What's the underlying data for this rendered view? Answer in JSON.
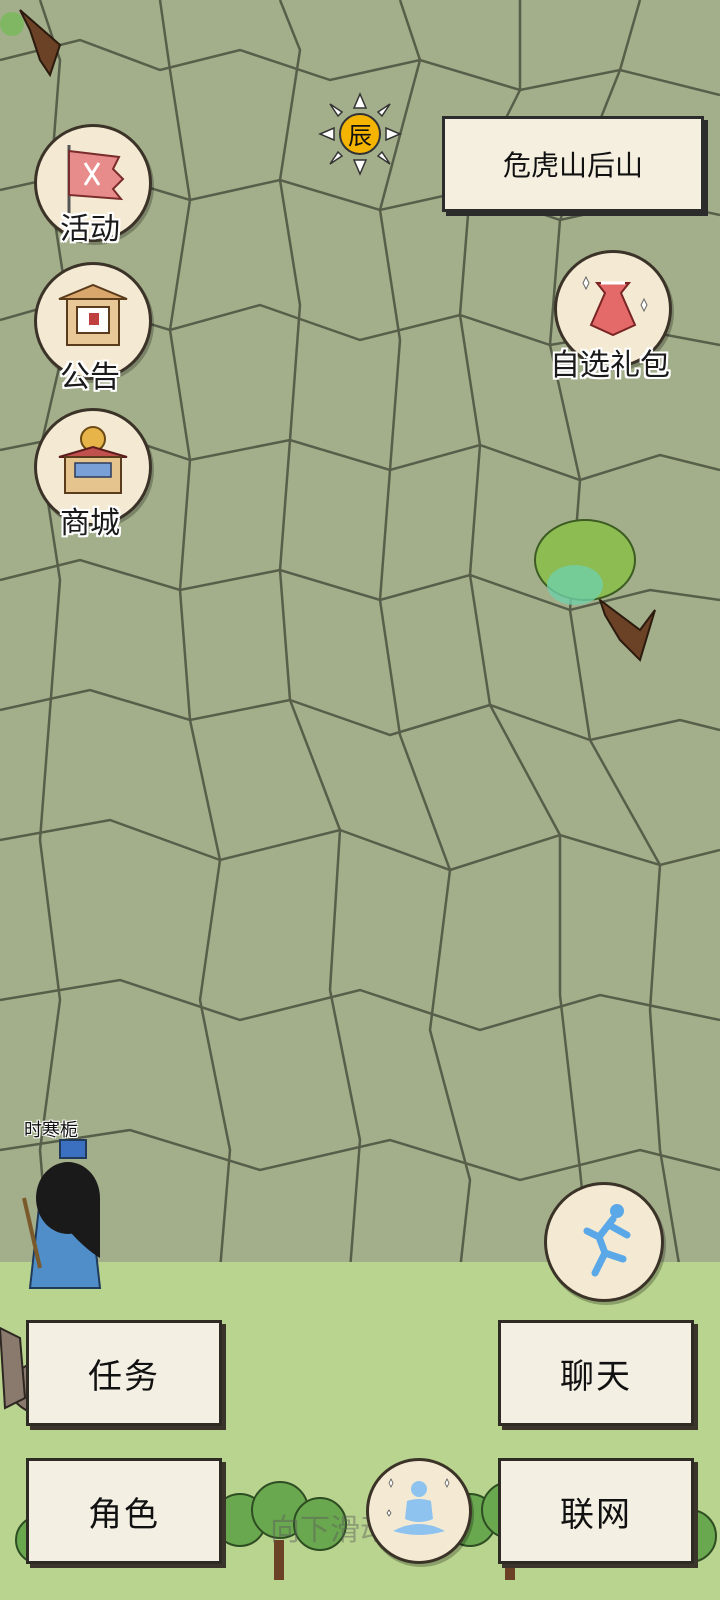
{
  "map": {
    "location_name": "危虎山后山",
    "time_marker": "辰"
  },
  "left_menu": [
    {
      "label": "活动",
      "icon": "banner-flag-icon"
    },
    {
      "label": "公告",
      "icon": "notice-pavilion-icon"
    },
    {
      "label": "商城",
      "icon": "shop-building-icon"
    }
  ],
  "right_menu": {
    "gift_label": "自选礼包",
    "gift_icon": "gift-pouch-icon"
  },
  "player": {
    "name": "时寒栀"
  },
  "bottom_buttons": {
    "task": "任务",
    "chat": "聊天",
    "character": "角色",
    "online": "联网"
  },
  "hint_text": "向下滑动屏幕",
  "icons": {
    "run": "running-figure-icon",
    "meditate": "meditation-figure-icon",
    "time": "sun-clock-icon"
  },
  "colors": {
    "cliff": "#9fad86",
    "grass": "#b9d48e",
    "button_bg": "#f4efe3"
  }
}
